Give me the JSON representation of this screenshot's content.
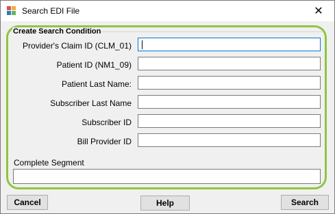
{
  "window": {
    "title": "Search EDI File",
    "close_icon": "close-icon",
    "app_icon": "grid-app-icon"
  },
  "group": {
    "legend": "Create Search Condition"
  },
  "fields": {
    "claim_id": {
      "label": "Provider's Claim ID (CLM_01)",
      "value": ""
    },
    "patient_id": {
      "label": "Patient ID (NM1_09)",
      "value": ""
    },
    "patient_last_name": {
      "label": "Patient Last Name:",
      "value": ""
    },
    "subscriber_last_name": {
      "label": "Subscriber Last Name",
      "value": ""
    },
    "subscriber_id": {
      "label": "Subscriber ID",
      "value": ""
    },
    "bill_provider_id": {
      "label": "Bill Provider ID",
      "value": ""
    },
    "complete_segment": {
      "label": "Complete Segment",
      "value": ""
    }
  },
  "buttons": {
    "cancel": "Cancel",
    "help": "Help",
    "search": "Search"
  },
  "colors": {
    "group_border": "#8dc63f",
    "focus_border": "#0078d7"
  }
}
